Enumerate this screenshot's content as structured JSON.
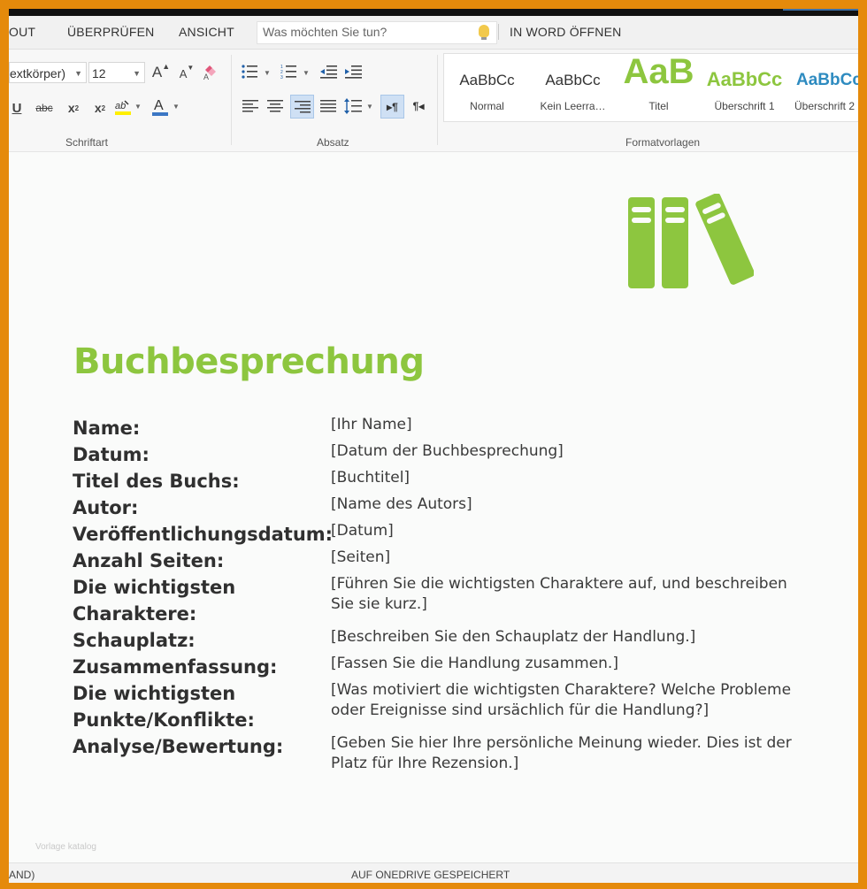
{
  "menu": {
    "items": [
      "OUT",
      "ÜBERPRÜFEN",
      "ANSICHT"
    ],
    "search_placeholder": "Was möchten Sie tun?",
    "open_in_word": "IN WORD ÖFFNEN"
  },
  "ribbon": {
    "font_name": "extkörper)",
    "font_size": "12",
    "group_font": "Schriftart",
    "group_paragraph": "Absatz",
    "group_styles": "Formatvorlagen",
    "styles": [
      {
        "sample": "AaBbCc",
        "name": "Normal"
      },
      {
        "sample": "AaBbCc",
        "name": "Kein Leerra…"
      },
      {
        "sample": "AaB",
        "name": "Titel"
      },
      {
        "sample": "AaBbCc",
        "name": "Überschrift 1"
      },
      {
        "sample": "AaBbCc",
        "name": "Überschrift 2"
      }
    ]
  },
  "colors": {
    "accent_green": "#8dc63f",
    "heading2_blue": "#2e8bc0",
    "frame_orange": "#e58a0b"
  },
  "document": {
    "title": "Buchbesprechung",
    "fields": [
      {
        "label": "Name:",
        "value": "[Ihr Name]"
      },
      {
        "label": "Datum:",
        "value": "[Datum der Buchbesprechung]"
      },
      {
        "label": "Titel des Buchs:",
        "value": "[Buchtitel]"
      },
      {
        "label": "Autor:",
        "value": "[Name des Autors]"
      },
      {
        "label": "Veröffentlichungsdatum:",
        "value": "[Datum]"
      },
      {
        "label": "Anzahl Seiten:",
        "value": "[Seiten]"
      },
      {
        "label": "Die wichtigsten Charaktere:",
        "value": "[Führen Sie die wichtigsten Charaktere auf, und beschreiben Sie sie kurz.]"
      },
      {
        "label": "Schauplatz:",
        "value": "[Beschreiben Sie den Schauplatz der Handlung.]"
      },
      {
        "label": "Zusammenfassung:",
        "value": "[Fassen Sie die Handlung zusammen.]"
      },
      {
        "label": "Die wichtigsten Punkte/Konflikte:",
        "value": "[Was motiviert die wichtigsten Charaktere? Welche Probleme oder Ereignisse sind ursächlich für die Handlung?]"
      },
      {
        "label": "Analyse/Bewertung:",
        "value": "[Geben Sie hier Ihre persönliche Meinung wieder. Dies ist der Platz für Ihre Rezension.]"
      }
    ],
    "watermark": "Vorlage katalog"
  },
  "status": {
    "left": "AND)",
    "center": "AUF ONEDRIVE GESPEICHERT"
  }
}
